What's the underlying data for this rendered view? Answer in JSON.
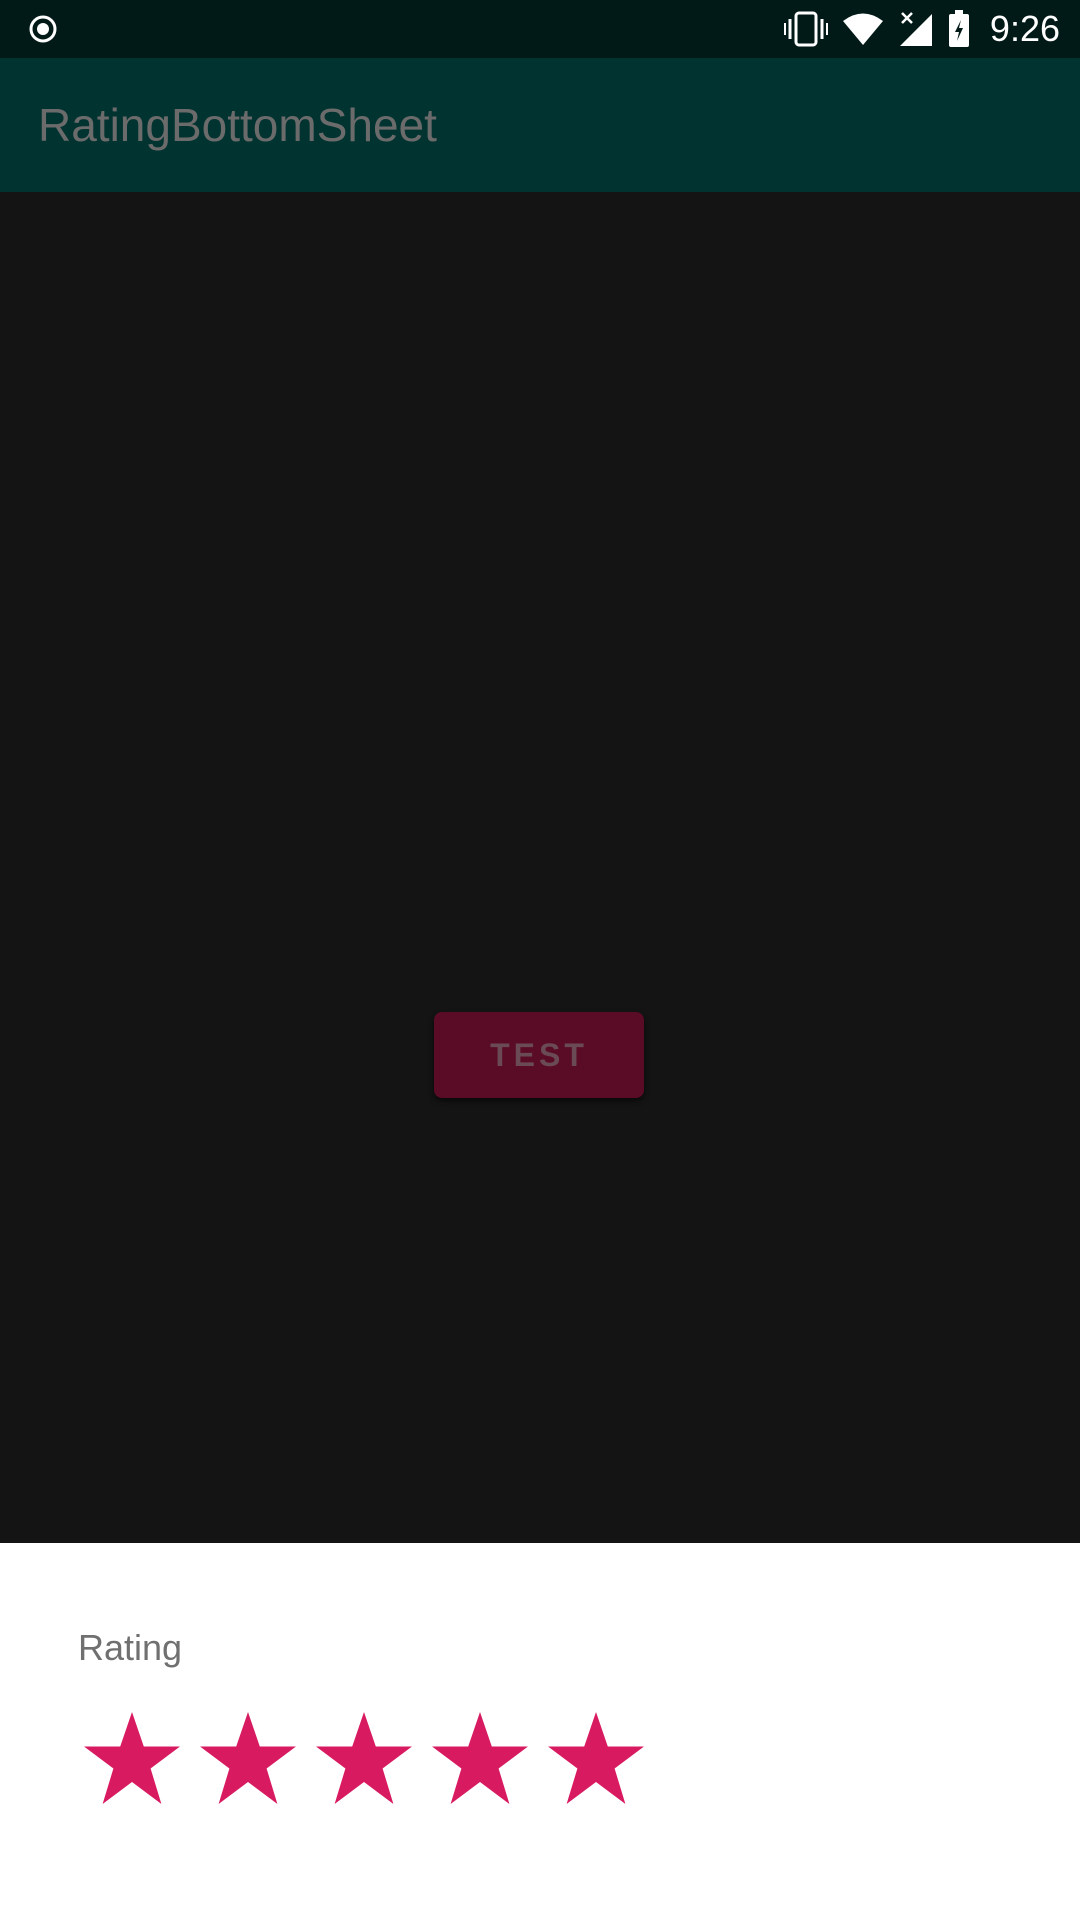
{
  "status_bar": {
    "time": "9:26",
    "icons": [
      "record-icon",
      "vibrate-icon",
      "wifi-icon",
      "cell-signal-icon",
      "battery-charging-icon"
    ]
  },
  "app_bar": {
    "title": "RatingBottomSheet"
  },
  "main": {
    "test_button_label": "TEST"
  },
  "bottom_sheet": {
    "label": "Rating",
    "rating": {
      "value": 5,
      "max": 5
    },
    "star_color": "#d81b60"
  },
  "colors": {
    "status_bar": "#021a17",
    "app_bar": "#013330",
    "scrim": "#141414",
    "accent": "#d81b60"
  }
}
